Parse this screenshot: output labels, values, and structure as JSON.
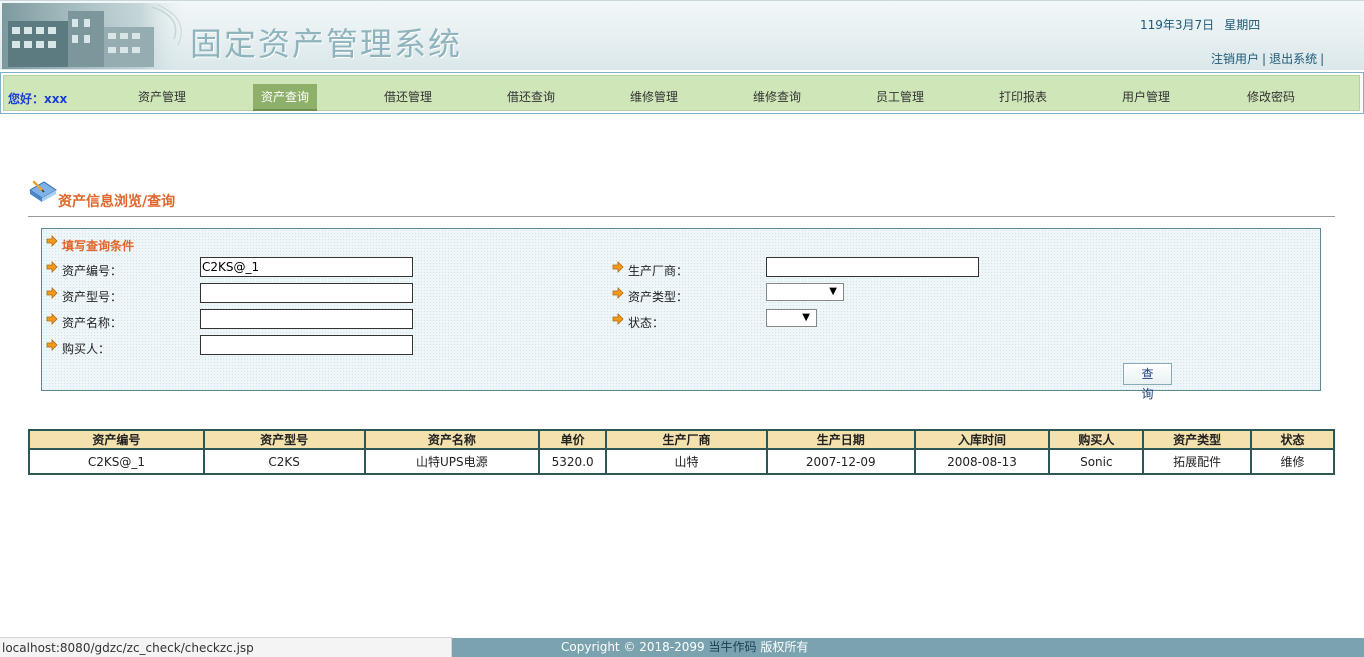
{
  "header": {
    "title": "固定资产管理系统",
    "date": "119年3月7日",
    "weekday": "星期四",
    "logout_user": "注销用户",
    "exit_system": "退出系统",
    "separator": "|"
  },
  "nav": {
    "greeting": "您好：xxx",
    "items": [
      {
        "label": "资产管理"
      },
      {
        "label": "资产查询"
      },
      {
        "label": "借还管理"
      },
      {
        "label": "借还查询"
      },
      {
        "label": "维修管理"
      },
      {
        "label": "维修查询"
      },
      {
        "label": "员工管理"
      },
      {
        "label": "打印报表"
      },
      {
        "label": "用户管理"
      },
      {
        "label": "修改密码"
      }
    ],
    "active": "资产查询"
  },
  "section": {
    "title": "资产信息浏览/查询"
  },
  "query": {
    "condition_title": "填写查询条件",
    "asset_no_label": "资产编号：",
    "asset_no_value": "C2KS@_1",
    "model_label": "资产型号：",
    "model_value": "",
    "name_label": "资产名称：",
    "name_value": "",
    "buyer_label": "购买人：",
    "buyer_value": "",
    "manufacturer_label": "生产厂商：",
    "manufacturer_value": "",
    "type_label": "资产类型：",
    "type_value": "",
    "status_label": "状态：",
    "status_value": "",
    "submit_label": "查 询"
  },
  "table": {
    "headers": [
      "资产编号",
      "资产型号",
      "资产名称",
      "单价",
      "生产厂商",
      "生产日期",
      "入库时间",
      "购买人",
      "资产类型",
      "状态"
    ],
    "rows": [
      [
        "C2KS@_1",
        "C2KS",
        "山特UPS电源",
        "5320.0",
        "山特",
        "2007-12-09",
        "2008-08-13",
        "Sonic",
        "拓展配件",
        "维修"
      ]
    ]
  },
  "statusbar": {
    "url": "localhost:8080/gdzc/zc_check/checkzc.jsp"
  },
  "footer": {
    "copyright": "Copyright © 2018-2099",
    "owner": "当牛作码",
    "rights": "版权所有"
  },
  "colors": {
    "nav_bg": "#cfe6b8",
    "nav_active": "#8fb06a",
    "accent_orange": "#e0662a",
    "table_header": "#f3e1ae",
    "table_border": "#2c5754",
    "footer_bg": "#7aa3af"
  }
}
